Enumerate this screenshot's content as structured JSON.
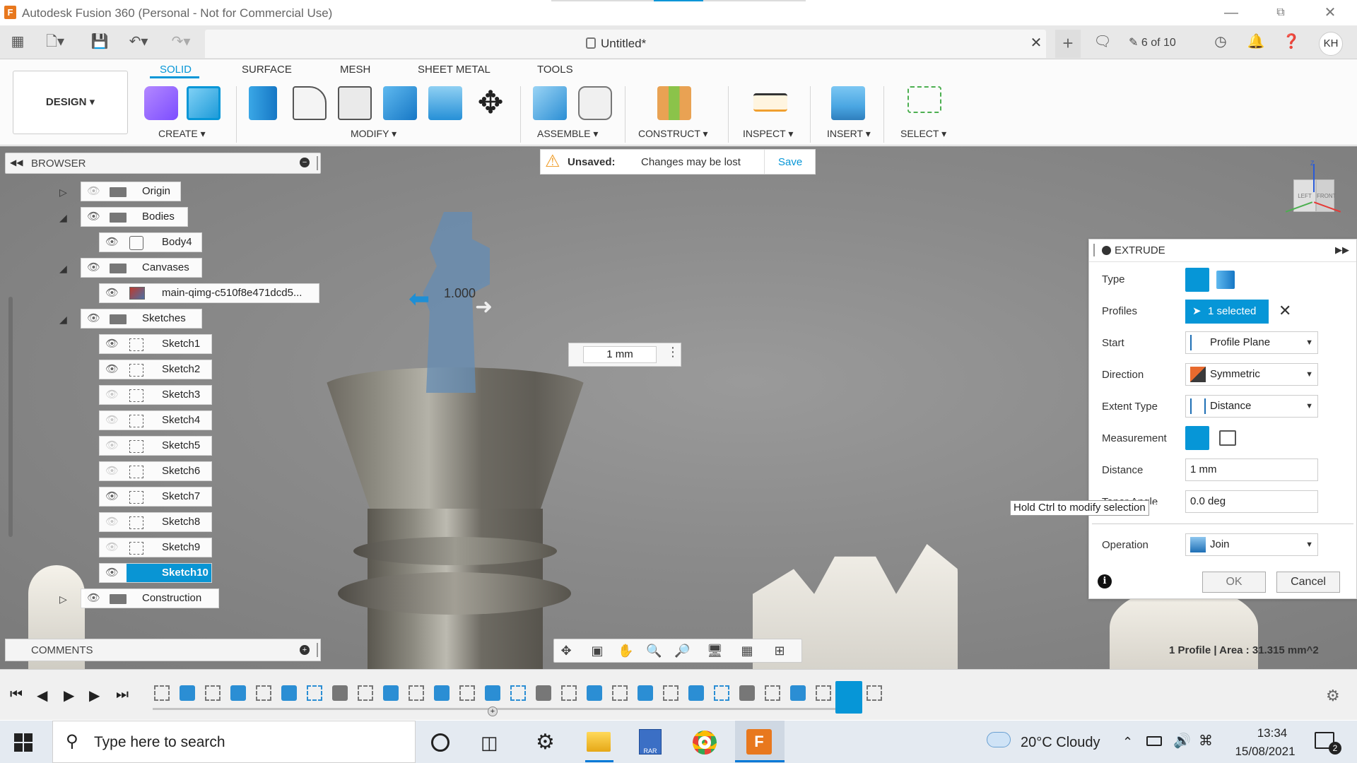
{
  "window": {
    "title": "Autodesk Fusion 360 (Personal - Not for Commercial Use)",
    "logo": "F"
  },
  "tabbar": {
    "doc_title": "Untitled*",
    "version_label": "6 of 10",
    "user_initials": "KH"
  },
  "ribbon": {
    "workspace": "DESIGN",
    "tabs": [
      "SOLID",
      "SURFACE",
      "MESH",
      "SHEET METAL",
      "TOOLS"
    ],
    "active_tab": "SOLID",
    "groups": [
      "CREATE",
      "MODIFY",
      "ASSEMBLE",
      "CONSTRUCT",
      "INSPECT",
      "INSERT",
      "SELECT"
    ]
  },
  "browser": {
    "title": "BROWSER",
    "items": [
      {
        "label": "Origin"
      },
      {
        "label": "Bodies"
      },
      {
        "label": "Body4"
      },
      {
        "label": "Canvases"
      },
      {
        "label": "main-qimg-c510f8e471dcd5..."
      },
      {
        "label": "Sketches"
      },
      {
        "label": "Construction"
      }
    ],
    "sketches": [
      "Sketch1",
      "Sketch2",
      "Sketch3",
      "Sketch4",
      "Sketch5",
      "Sketch6",
      "Sketch7",
      "Sketch8",
      "Sketch9",
      "Sketch10"
    ]
  },
  "unsaved_banner": {
    "label": "Unsaved:",
    "message": "Changes may be lost",
    "save": "Save"
  },
  "distance_input": {
    "value": "1 mm"
  },
  "dim_annotation": "1.000",
  "viewcube": {
    "left": "LEFT",
    "front": "FRONT",
    "z": "Z"
  },
  "extrude": {
    "title": "EXTRUDE",
    "labels": {
      "type": "Type",
      "profiles": "Profiles",
      "start": "Start",
      "direction": "Direction",
      "extent_type": "Extent Type",
      "measurement": "Measurement",
      "distance": "Distance",
      "taper": "Taper Angle",
      "operation": "Operation"
    },
    "profiles_value": "1 selected",
    "start_value": "Profile Plane",
    "direction_value": "Symmetric",
    "extent_value": "Distance",
    "distance_value": "1 mm",
    "taper_value": "0.0 deg",
    "operation_value": "Join",
    "ok": "OK",
    "cancel": "Cancel"
  },
  "tooltip": "Hold Ctrl to modify selection",
  "comments": {
    "title": "COMMENTS"
  },
  "status": {
    "text": "1 Profile | Area : 31.315 mm^2"
  },
  "taskbar": {
    "search_placeholder": "Type here to search",
    "weather": "20°C  Cloudy",
    "time": "13:34",
    "date": "15/08/2021",
    "notifications": "2"
  },
  "colors": {
    "accent": "#0696d7",
    "fusion_orange": "#e8781e"
  }
}
